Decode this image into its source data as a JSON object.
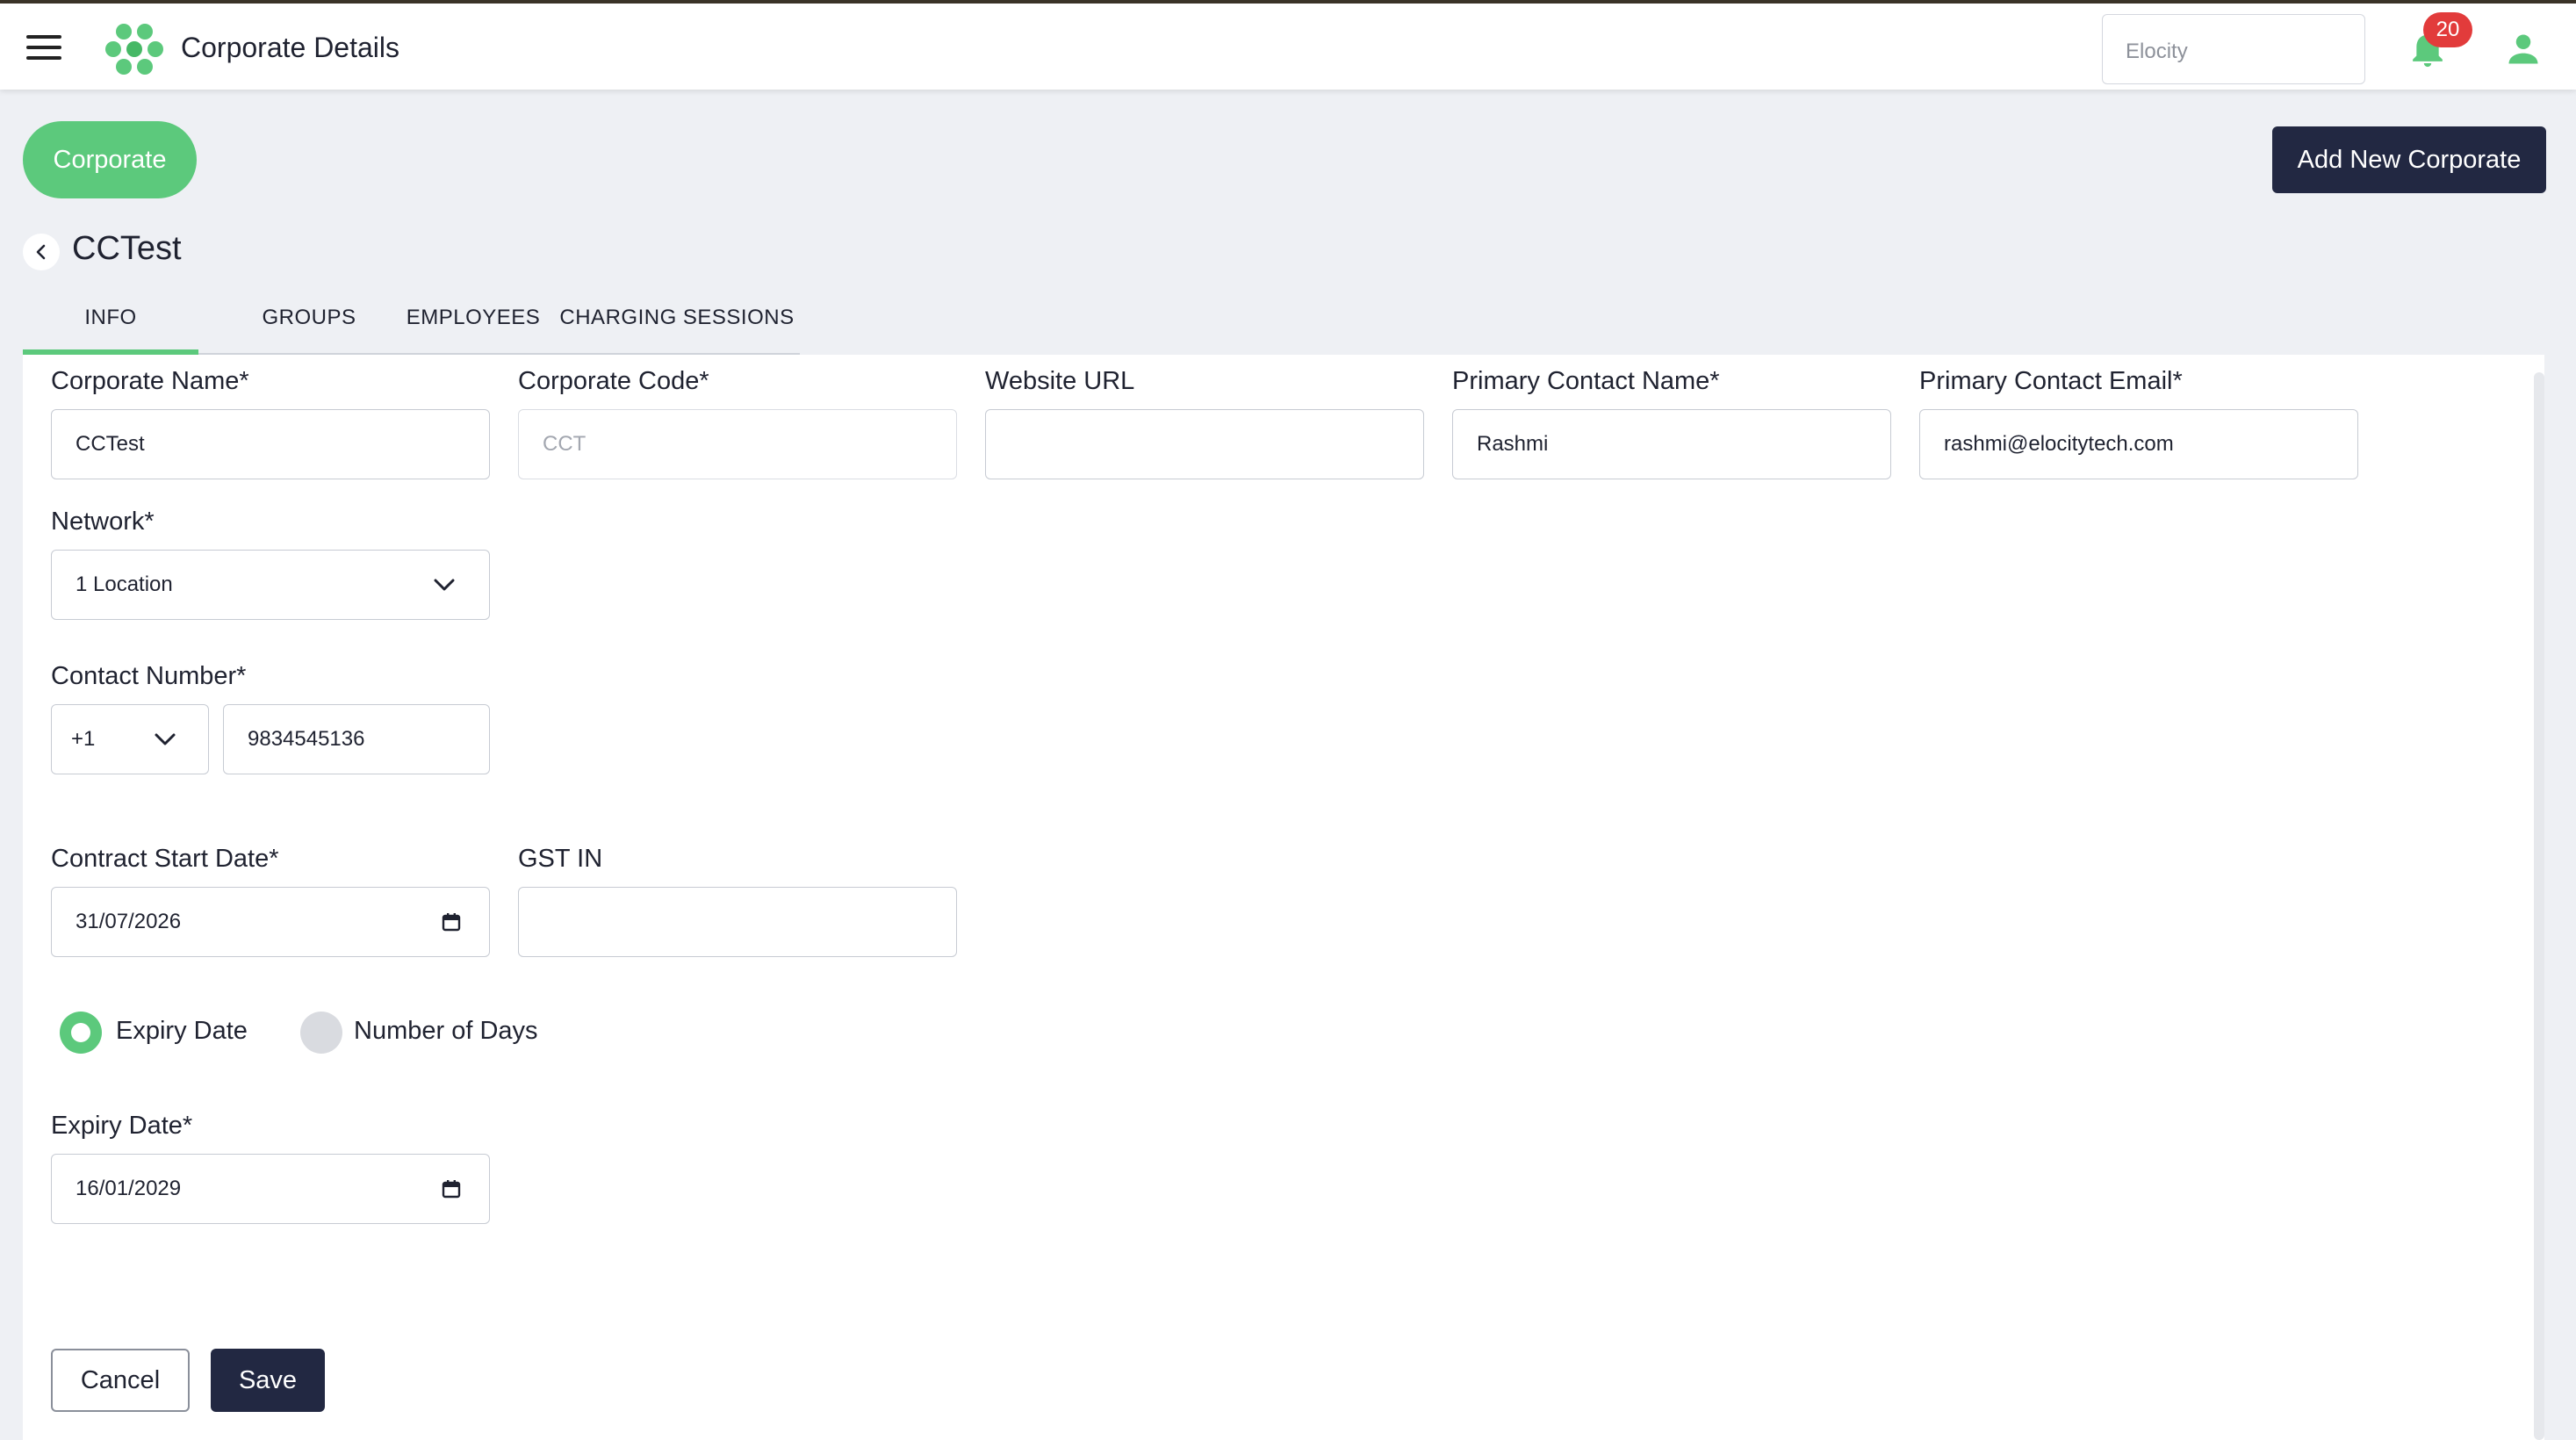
{
  "header": {
    "title": "Corporate Details",
    "org_selector": "Elocity",
    "notification_count": "20",
    "accent_color": "#5cc97c"
  },
  "actions": {
    "corporate_pill": "Corporate",
    "add_new_corporate": "Add New Corporate"
  },
  "page": {
    "heading": "CCTest"
  },
  "tabs": [
    {
      "label": "INFO",
      "active": true
    },
    {
      "label": "GROUPS",
      "active": false
    },
    {
      "label": "EMPLOYEES",
      "active": false
    },
    {
      "label": "CHARGING SESSIONS",
      "active": false
    }
  ],
  "form": {
    "corporate_name": {
      "label": "Corporate Name*",
      "value": "CCTest"
    },
    "corporate_code": {
      "label": "Corporate Code*",
      "value": "CCT"
    },
    "website_url": {
      "label": "Website URL",
      "value": ""
    },
    "primary_contact_name": {
      "label": "Primary Contact Name*",
      "value": "Rashmi"
    },
    "primary_contact_email": {
      "label": "Primary Contact Email*",
      "value": "rashmi@elocitytech.com"
    },
    "network": {
      "label": "Network*",
      "value": "1 Location"
    },
    "contact_number": {
      "label": "Contact Number*",
      "country_code": "+1",
      "value": "9834545136"
    },
    "contract_start_date": {
      "label": "Contract Start Date*",
      "value": "31/07/2026"
    },
    "gst_in": {
      "label": "GST IN",
      "value": ""
    },
    "expiry_mode": {
      "options": [
        "Expiry Date",
        "Number of Days"
      ],
      "selected": "Expiry Date"
    },
    "expiry_date": {
      "label": "Expiry Date*",
      "value": "16/01/2029"
    },
    "cancel_label": "Cancel",
    "save_label": "Save"
  },
  "icons": {
    "menu": "hamburger-icon",
    "logo": "hexagon-cluster-logo",
    "notifications": "bell-icon",
    "user": "user-icon",
    "back": "chevron-left-icon",
    "dropdown": "chevron-down-icon",
    "calendar": "calendar-icon"
  }
}
